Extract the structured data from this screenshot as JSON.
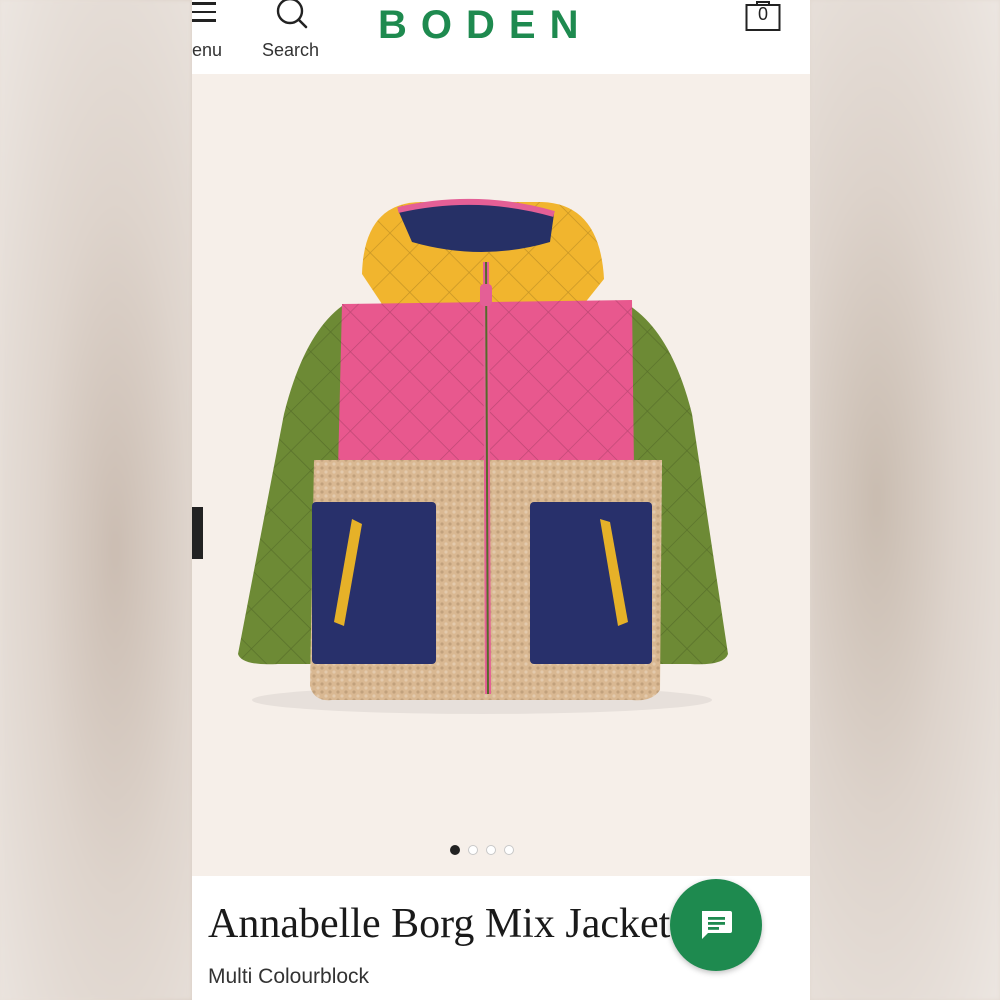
{
  "header": {
    "menu_label": "enu",
    "search_label": "Search",
    "logo_text": "BODEN",
    "bag_count": "0"
  },
  "gallery": {
    "image_icon": "hooded-colourblock-jacket",
    "dots": [
      "active",
      "",
      "",
      ""
    ]
  },
  "product": {
    "title": "Annabelle Borg Mix Jacket",
    "subtitle": "Multi Colourblock"
  },
  "chat": {
    "icon": "chat-bubble-icon"
  },
  "colors": {
    "brand_green": "#1e8a4f",
    "gallery_bg": "#f6efe9"
  }
}
